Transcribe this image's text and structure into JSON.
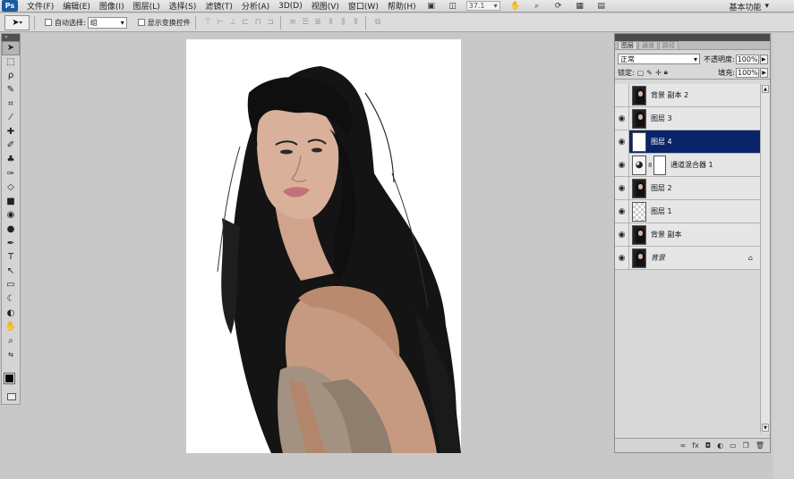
{
  "app": {
    "logo": "Ps"
  },
  "menu": {
    "items": [
      "文件(F)",
      "编辑(E)",
      "图像(I)",
      "图层(L)",
      "选择(S)",
      "滤镜(T)",
      "分析(A)",
      "3D(D)",
      "视图(V)",
      "窗口(W)",
      "帮助(H)"
    ],
    "zoom": "37.1",
    "workspace": "基本功能"
  },
  "options": {
    "auto_select_label": "自动选择:",
    "auto_select_value": "组",
    "show_transform_label": "显示变换控件"
  },
  "layers_panel": {
    "tabs": [
      "图层",
      "通道",
      "路径"
    ],
    "blend_mode": "正常",
    "opacity_label": "不透明度:",
    "opacity_value": "100%",
    "lock_label": "锁定:",
    "fill_label": "填充:",
    "fill_value": "100%",
    "layers": [
      {
        "name": "背景 副本 2",
        "visible": false,
        "thumb": "portrait",
        "selected": false
      },
      {
        "name": "图层 3",
        "visible": true,
        "thumb": "portrait",
        "selected": false
      },
      {
        "name": "图层 4",
        "visible": true,
        "thumb": "white",
        "selected": true
      },
      {
        "name": "通道混合器 1",
        "visible": true,
        "thumb": "adjustment",
        "selected": false
      },
      {
        "name": "图层 2",
        "visible": true,
        "thumb": "portrait",
        "selected": false
      },
      {
        "name": "图层 1",
        "visible": true,
        "thumb": "transparent",
        "selected": false
      },
      {
        "name": "背景 副本",
        "visible": true,
        "thumb": "portrait",
        "selected": false
      },
      {
        "name": "背景",
        "visible": true,
        "thumb": "portrait",
        "selected": false,
        "locked": true
      }
    ]
  }
}
